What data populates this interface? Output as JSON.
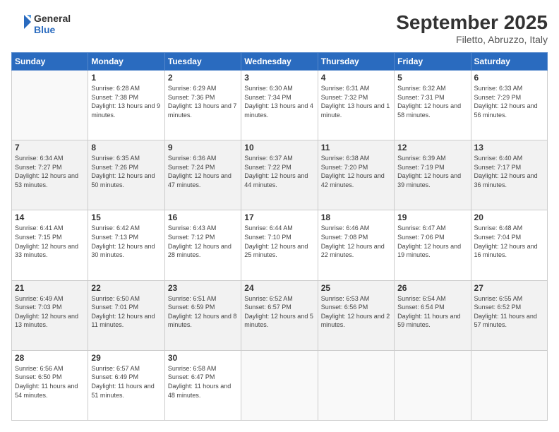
{
  "logo": {
    "line1": "General",
    "line2": "Blue"
  },
  "title": "September 2025",
  "subtitle": "Filetto, Abruzzo, Italy",
  "headers": [
    "Sunday",
    "Monday",
    "Tuesday",
    "Wednesday",
    "Thursday",
    "Friday",
    "Saturday"
  ],
  "weeks": [
    [
      {
        "day": "",
        "sunrise": "",
        "sunset": "",
        "daylight": ""
      },
      {
        "day": "1",
        "sunrise": "Sunrise: 6:28 AM",
        "sunset": "Sunset: 7:38 PM",
        "daylight": "Daylight: 13 hours and 9 minutes."
      },
      {
        "day": "2",
        "sunrise": "Sunrise: 6:29 AM",
        "sunset": "Sunset: 7:36 PM",
        "daylight": "Daylight: 13 hours and 7 minutes."
      },
      {
        "day": "3",
        "sunrise": "Sunrise: 6:30 AM",
        "sunset": "Sunset: 7:34 PM",
        "daylight": "Daylight: 13 hours and 4 minutes."
      },
      {
        "day": "4",
        "sunrise": "Sunrise: 6:31 AM",
        "sunset": "Sunset: 7:32 PM",
        "daylight": "Daylight: 13 hours and 1 minute."
      },
      {
        "day": "5",
        "sunrise": "Sunrise: 6:32 AM",
        "sunset": "Sunset: 7:31 PM",
        "daylight": "Daylight: 12 hours and 58 minutes."
      },
      {
        "day": "6",
        "sunrise": "Sunrise: 6:33 AM",
        "sunset": "Sunset: 7:29 PM",
        "daylight": "Daylight: 12 hours and 56 minutes."
      }
    ],
    [
      {
        "day": "7",
        "sunrise": "Sunrise: 6:34 AM",
        "sunset": "Sunset: 7:27 PM",
        "daylight": "Daylight: 12 hours and 53 minutes."
      },
      {
        "day": "8",
        "sunrise": "Sunrise: 6:35 AM",
        "sunset": "Sunset: 7:26 PM",
        "daylight": "Daylight: 12 hours and 50 minutes."
      },
      {
        "day": "9",
        "sunrise": "Sunrise: 6:36 AM",
        "sunset": "Sunset: 7:24 PM",
        "daylight": "Daylight: 12 hours and 47 minutes."
      },
      {
        "day": "10",
        "sunrise": "Sunrise: 6:37 AM",
        "sunset": "Sunset: 7:22 PM",
        "daylight": "Daylight: 12 hours and 44 minutes."
      },
      {
        "day": "11",
        "sunrise": "Sunrise: 6:38 AM",
        "sunset": "Sunset: 7:20 PM",
        "daylight": "Daylight: 12 hours and 42 minutes."
      },
      {
        "day": "12",
        "sunrise": "Sunrise: 6:39 AM",
        "sunset": "Sunset: 7:19 PM",
        "daylight": "Daylight: 12 hours and 39 minutes."
      },
      {
        "day": "13",
        "sunrise": "Sunrise: 6:40 AM",
        "sunset": "Sunset: 7:17 PM",
        "daylight": "Daylight: 12 hours and 36 minutes."
      }
    ],
    [
      {
        "day": "14",
        "sunrise": "Sunrise: 6:41 AM",
        "sunset": "Sunset: 7:15 PM",
        "daylight": "Daylight: 12 hours and 33 minutes."
      },
      {
        "day": "15",
        "sunrise": "Sunrise: 6:42 AM",
        "sunset": "Sunset: 7:13 PM",
        "daylight": "Daylight: 12 hours and 30 minutes."
      },
      {
        "day": "16",
        "sunrise": "Sunrise: 6:43 AM",
        "sunset": "Sunset: 7:12 PM",
        "daylight": "Daylight: 12 hours and 28 minutes."
      },
      {
        "day": "17",
        "sunrise": "Sunrise: 6:44 AM",
        "sunset": "Sunset: 7:10 PM",
        "daylight": "Daylight: 12 hours and 25 minutes."
      },
      {
        "day": "18",
        "sunrise": "Sunrise: 6:46 AM",
        "sunset": "Sunset: 7:08 PM",
        "daylight": "Daylight: 12 hours and 22 minutes."
      },
      {
        "day": "19",
        "sunrise": "Sunrise: 6:47 AM",
        "sunset": "Sunset: 7:06 PM",
        "daylight": "Daylight: 12 hours and 19 minutes."
      },
      {
        "day": "20",
        "sunrise": "Sunrise: 6:48 AM",
        "sunset": "Sunset: 7:04 PM",
        "daylight": "Daylight: 12 hours and 16 minutes."
      }
    ],
    [
      {
        "day": "21",
        "sunrise": "Sunrise: 6:49 AM",
        "sunset": "Sunset: 7:03 PM",
        "daylight": "Daylight: 12 hours and 13 minutes."
      },
      {
        "day": "22",
        "sunrise": "Sunrise: 6:50 AM",
        "sunset": "Sunset: 7:01 PM",
        "daylight": "Daylight: 12 hours and 11 minutes."
      },
      {
        "day": "23",
        "sunrise": "Sunrise: 6:51 AM",
        "sunset": "Sunset: 6:59 PM",
        "daylight": "Daylight: 12 hours and 8 minutes."
      },
      {
        "day": "24",
        "sunrise": "Sunrise: 6:52 AM",
        "sunset": "Sunset: 6:57 PM",
        "daylight": "Daylight: 12 hours and 5 minutes."
      },
      {
        "day": "25",
        "sunrise": "Sunrise: 6:53 AM",
        "sunset": "Sunset: 6:56 PM",
        "daylight": "Daylight: 12 hours and 2 minutes."
      },
      {
        "day": "26",
        "sunrise": "Sunrise: 6:54 AM",
        "sunset": "Sunset: 6:54 PM",
        "daylight": "Daylight: 11 hours and 59 minutes."
      },
      {
        "day": "27",
        "sunrise": "Sunrise: 6:55 AM",
        "sunset": "Sunset: 6:52 PM",
        "daylight": "Daylight: 11 hours and 57 minutes."
      }
    ],
    [
      {
        "day": "28",
        "sunrise": "Sunrise: 6:56 AM",
        "sunset": "Sunset: 6:50 PM",
        "daylight": "Daylight: 11 hours and 54 minutes."
      },
      {
        "day": "29",
        "sunrise": "Sunrise: 6:57 AM",
        "sunset": "Sunset: 6:49 PM",
        "daylight": "Daylight: 11 hours and 51 minutes."
      },
      {
        "day": "30",
        "sunrise": "Sunrise: 6:58 AM",
        "sunset": "Sunset: 6:47 PM",
        "daylight": "Daylight: 11 hours and 48 minutes."
      },
      {
        "day": "",
        "sunrise": "",
        "sunset": "",
        "daylight": ""
      },
      {
        "day": "",
        "sunrise": "",
        "sunset": "",
        "daylight": ""
      },
      {
        "day": "",
        "sunrise": "",
        "sunset": "",
        "daylight": ""
      },
      {
        "day": "",
        "sunrise": "",
        "sunset": "",
        "daylight": ""
      }
    ]
  ]
}
